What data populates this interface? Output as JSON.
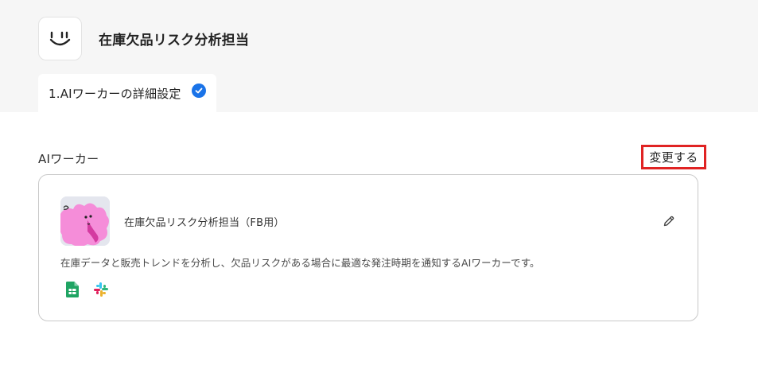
{
  "header": {
    "title": "在庫欠品リスク分析担当",
    "logo_icon": "smile-logo-icon"
  },
  "steps": [
    {
      "label": "1.AIワーカーの詳細設定",
      "status_icon": "check-circle-icon",
      "status_color": "#1a73e8"
    }
  ],
  "section": {
    "title": "AIワーカー",
    "change_label": "変更する",
    "highlight_color": "#e02323"
  },
  "worker": {
    "name": "在庫欠品リスク分析担当（FB用）",
    "description": "在庫データと販売トレンドを分析し、欠品リスクがある場合に最適な発注時期を通知するAIワーカーです。",
    "edit_icon": "pencil-icon",
    "tools": [
      {
        "icon": "google-sheets-icon",
        "color": "#1fa463"
      },
      {
        "icon": "slack-icon",
        "color": "#e01e5a"
      }
    ]
  }
}
